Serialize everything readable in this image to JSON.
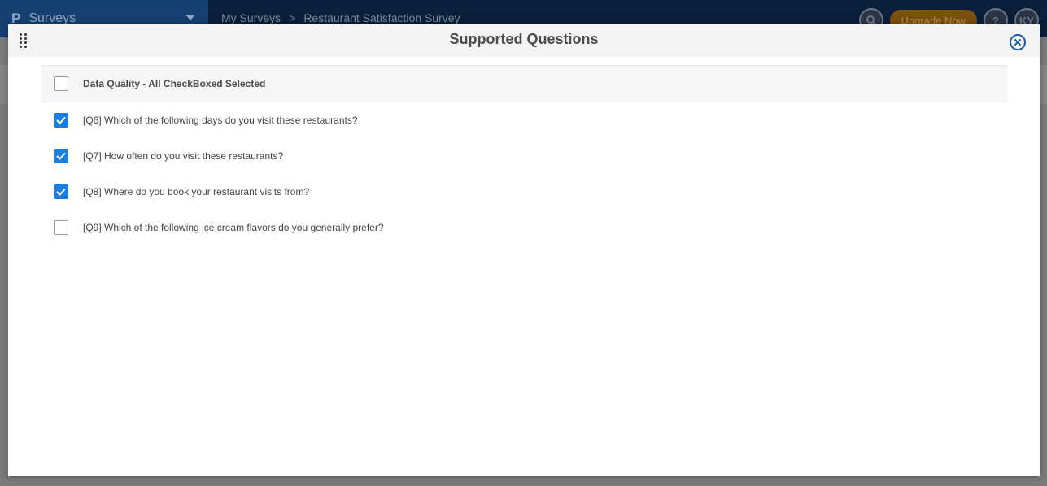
{
  "app": {
    "brand_logo": "P",
    "brand_name": "Surveys",
    "breadcrumb": [
      "My Surveys",
      ">",
      "Restaurant Satisfaction Survey"
    ],
    "upgrade_label": "Upgrade Now",
    "help_label": "?",
    "avatar_initials": "KY"
  },
  "modal": {
    "title": "Supported Questions",
    "select_all": {
      "label": "Data Quality - All CheckBoxed Selected",
      "checked": false
    },
    "questions": [
      {
        "label": "[Q6] Which of the following days do you visit these restaurants?",
        "checked": true
      },
      {
        "label": "[Q7] How often do you visit these restaurants?",
        "checked": true
      },
      {
        "label": "[Q8] Where do you book your restaurant visits from?",
        "checked": true
      },
      {
        "label": "[Q9] Which of the following ice cream flavors do you generally prefer?",
        "checked": false
      }
    ]
  },
  "colors": {
    "accent": "#1c7ee0",
    "close_icon": "#1b5fa8"
  }
}
